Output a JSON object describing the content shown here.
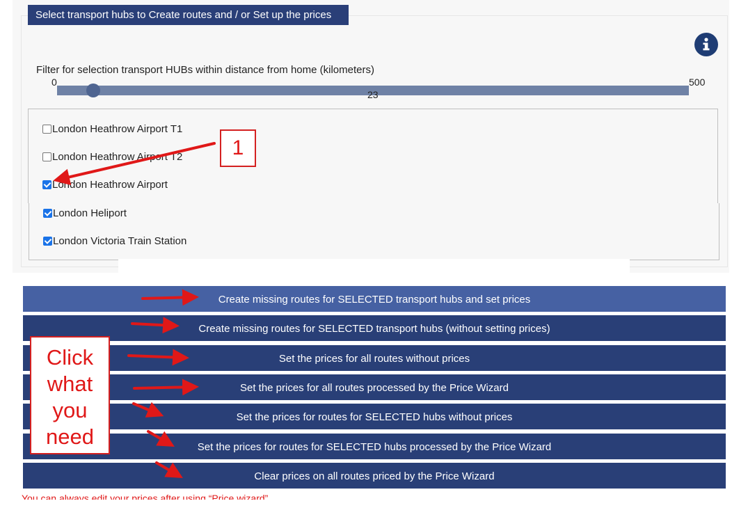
{
  "header": {
    "title": "Select transport hubs to Create routes and / or Set up the prices"
  },
  "info_icon": "info-circle-icon",
  "filter": {
    "label": "Filter for selection transport HUBs within distance from home (kilometers)",
    "min": "0",
    "max": "500",
    "value": "23",
    "value_fraction": 0.046
  },
  "hubs": [
    {
      "label": "London Heathrow Airport T1",
      "checked": false
    },
    {
      "label": "London Heathrow Airport T2",
      "checked": false
    },
    {
      "label": "London Heathrow Airport",
      "checked": true
    },
    {
      "label": "London Heliport",
      "checked": true
    },
    {
      "label": "London Victoria Train Station",
      "checked": true
    }
  ],
  "annotations": {
    "marker_1": "1",
    "click_note": [
      "Click",
      "what",
      "you",
      "need"
    ]
  },
  "actions": [
    {
      "label": "Create missing routes for SELECTED transport hubs and set prices"
    },
    {
      "label": "Create missing routes for SELECTED transport hubs (without setting prices)"
    },
    {
      "label": "Set the prices for all routes without prices"
    },
    {
      "label": "Set the prices for all routes processed by the Price Wizard"
    },
    {
      "label": "Set the prices for routes for SELECTED hubs without prices"
    },
    {
      "label": "Set the prices for routes for SELECTED hubs processed by the Price Wizard"
    },
    {
      "label": "Clear prices on all routes priced by the Price Wizard"
    }
  ],
  "footer": {
    "note": "You can always edit your prices after using “Price wizard”"
  },
  "colors": {
    "primary": "#293f77",
    "primary_highlight": "#4661a3",
    "annotation_red": "#e01818"
  }
}
